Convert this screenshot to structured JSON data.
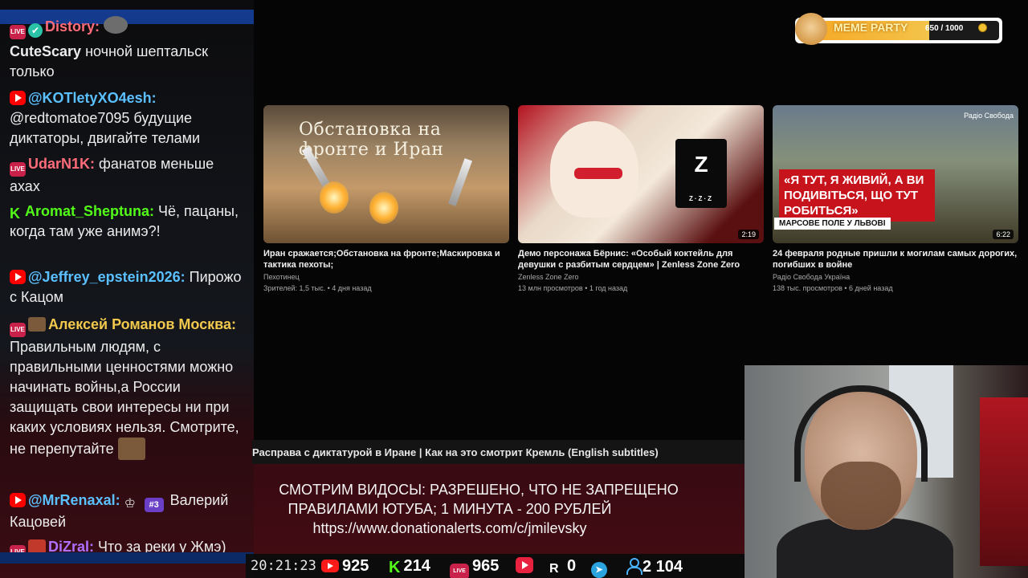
{
  "chat": {
    "messages": [
      {
        "user": "Distory:",
        "color": "#ff6c7a",
        "text": ""
      },
      {
        "user": "CuteScary",
        "color": "#ffffff",
        "text": "ночной шептальск только"
      },
      {
        "user": "@KOTletyXO4esh:",
        "color": "#5bc0ff",
        "text": "@redtomatoe7095 будущие диктаторы, двигайте телами"
      },
      {
        "user": "UdarN1K:",
        "color": "#ff6c7a",
        "text": "фанатов меньше ахах"
      },
      {
        "user": "Aromat_Sheptuna:",
        "color": "#53fc18",
        "text": "Чё, пацаны, когда там уже анимэ?!"
      },
      {
        "user": "@Jeffrey_epstein2026:",
        "color": "#5bc0ff",
        "text": "Пирожо с Кацом"
      },
      {
        "user": "Алексей Романов Москва:",
        "color": "#f2c94c",
        "text": "Правильным людям, с правильными ценностями можно начинать войны,а России защищать свои интересы ни при каких условиях нельзя. Смотрите, не перепутайте"
      },
      {
        "user": "@MrRenaxal:",
        "color": "#5bc0ff",
        "badge": "#3",
        "text": "Валерий Кацовей"
      },
      {
        "user": "DiZral:",
        "color": "#b070ff",
        "text": "Что за реки у Жмэ)"
      }
    ]
  },
  "videos": [
    {
      "thumb_text": "Обстановка на фронте и Иран",
      "title": "Иран сражается;Обстановка на фронте;Маскировка и тактика пехоты;",
      "channel": "Пехотинец",
      "meta": "Зрителей: 1,5 тыс. • 4 дня назад",
      "duration": ""
    },
    {
      "thumb_text": "Z",
      "thumb_sub": "Z·Z·Z",
      "title": "Демо персонажа Бёрнис: «Особый коктейль для девушки с разбитым сердцем» | Zenless Zone Zero",
      "channel": "Zenless Zone Zero",
      "meta": "13 млн просмотров • 1 год назад",
      "duration": "2:19"
    },
    {
      "thumb_text": "«Я ТУТ, Я ЖИВИЙ, А ВИ ПОДИВІТЬСЯ, ЩО ТУТ РОБИТЬСЯ»",
      "thumb_tag": "МАРСОВЕ ПОЛЕ У ЛЬВОВІ",
      "thumb_logo": "Радіо Свобода",
      "title": "24 февраля родные пришли к могилам самых дорогих, погибших в войне",
      "channel": "Радіо Свобода Україна",
      "meta": "138 тыс. просмотров • 6 дней назад",
      "duration": "6:22"
    }
  ],
  "meme_party": {
    "title": "MEME PARTY",
    "count": "650 / 1000",
    "progress": 0.65
  },
  "now_playing": "Расправа с диктатурой в Иране | Как на это смотрит Кремль (English subtitles)",
  "banner": {
    "line1": "СМОТРИМ ВИДОСЫ: РАЗРЕШЕНО, ЧТО НЕ ЗАПРЕЩЕНО",
    "line2": "ПРАВИЛАМИ ЮТУБА; 1 МИНУТА - 200 РУБЛЕЙ",
    "line3": "https://www.donationalerts.com/c/jmilevsky"
  },
  "stats": {
    "clock": "20:21:23",
    "youtube": "925",
    "kick": "214",
    "vk": "965",
    "play_icon": "vk-play-icon",
    "rumble": "0",
    "telegram_icon": "telegram-icon",
    "viewers": "2 104"
  }
}
